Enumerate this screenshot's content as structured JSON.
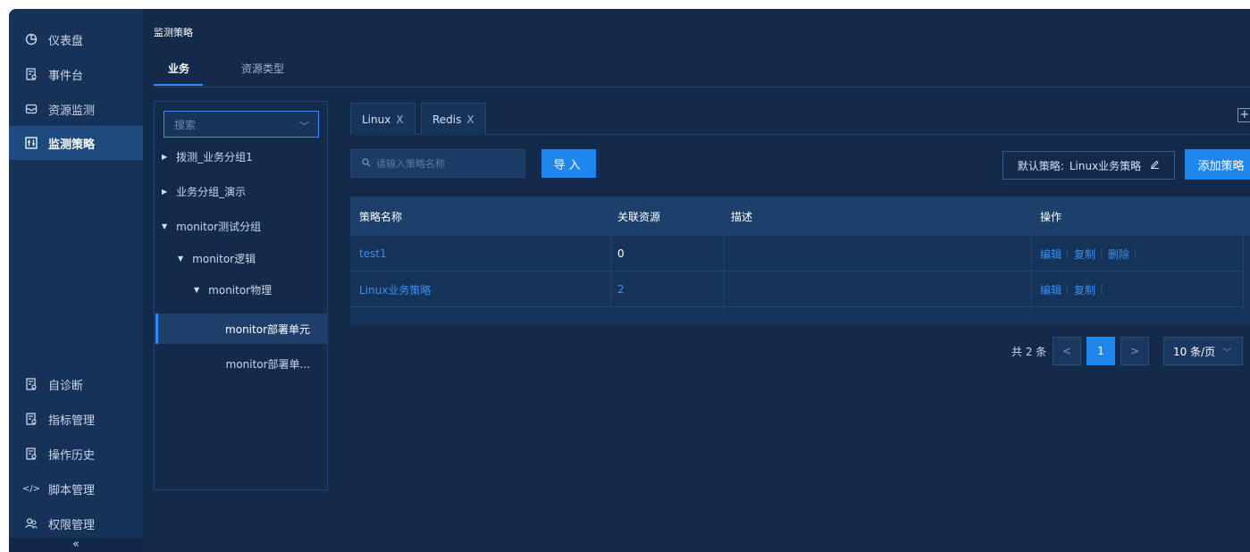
{
  "sidebar": {
    "top_items": [
      {
        "label": "仪表盘",
        "icon": "pie-chart-icon"
      },
      {
        "label": "事件台",
        "icon": "document-icon"
      },
      {
        "label": "资源监测",
        "icon": "inbox-icon"
      },
      {
        "label": "监测策略",
        "icon": "policy-icon",
        "active": true
      }
    ],
    "bottom_items": [
      {
        "label": "自诊断",
        "icon": "document-icon"
      },
      {
        "label": "指标管理",
        "icon": "document-icon"
      },
      {
        "label": "操作历史",
        "icon": "document-icon"
      },
      {
        "label": "脚本管理",
        "icon": "code-icon"
      },
      {
        "label": "权限管理",
        "icon": "users-icon"
      }
    ],
    "collapse_label": "«"
  },
  "page": {
    "title": "监测策略",
    "tabs": [
      {
        "label": "业务",
        "active": true
      },
      {
        "label": "资源类型",
        "active": false
      }
    ]
  },
  "tree": {
    "search_placeholder": "搜索",
    "nodes": [
      {
        "label": "拨测_业务分组1",
        "expanded": false
      },
      {
        "label": "业务分组_演示",
        "expanded": false
      },
      {
        "label": "monitor测试分组",
        "expanded": true
      },
      {
        "label": "monitor逻辑",
        "expanded": true
      },
      {
        "label": "monitor物理",
        "expanded": true
      },
      {
        "label": "monitor部署单元",
        "selected": true
      },
      {
        "label": "monitor部署单..."
      }
    ]
  },
  "resource_tabs": {
    "chips": [
      {
        "label": "Linux",
        "close": "X"
      },
      {
        "label": "Redis",
        "close": "X"
      }
    ],
    "add_label": "+"
  },
  "toolbar": {
    "search_placeholder": "请输入策略名称",
    "import_label": "导入",
    "default_policy_label": "默认策略:",
    "default_policy_value": "Linux业务策略",
    "add_label": "添加策略"
  },
  "table": {
    "headers": [
      "策略名称",
      "关联资源",
      "描述",
      "操作"
    ],
    "rows": [
      {
        "name": "test1",
        "count": "0",
        "desc": "",
        "actions": [
          "编辑",
          "复制",
          "删除"
        ]
      },
      {
        "name": "Linux业务策略",
        "count": "2",
        "desc": "",
        "actions": [
          "编辑",
          "复制"
        ]
      }
    ]
  },
  "pagination": {
    "total": "共 2 条",
    "prev": "<",
    "current": "1",
    "next": ">",
    "page_size": "10 条/页"
  },
  "colors": {
    "background": "#142a4b",
    "sidebar": "#173258",
    "accent": "#1f86ee",
    "link": "#3a8ef0"
  }
}
